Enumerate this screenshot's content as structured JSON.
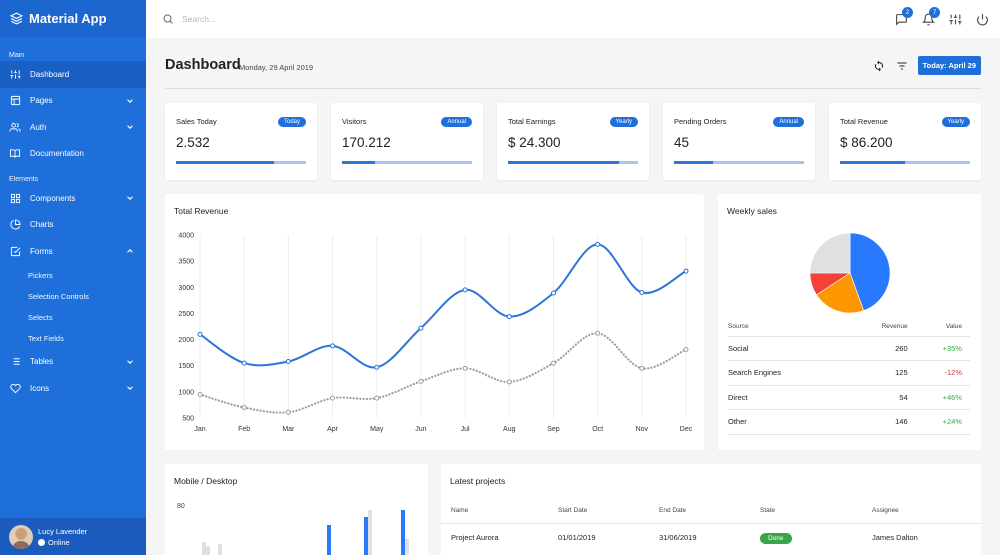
{
  "app": {
    "name": "Material App"
  },
  "sidebar": {
    "section_main": "Main",
    "section_elements": "Elements",
    "items": [
      {
        "label": "Dashboard"
      },
      {
        "label": "Pages"
      },
      {
        "label": "Auth"
      },
      {
        "label": "Documentation"
      },
      {
        "label": "Components"
      },
      {
        "label": "Charts"
      },
      {
        "label": "Forms"
      },
      {
        "label": "Tables"
      },
      {
        "label": "Icons"
      }
    ],
    "forms_sub": [
      {
        "label": "Pickers"
      },
      {
        "label": "Selection Controls"
      },
      {
        "label": "Selects"
      },
      {
        "label": "Text Fields"
      }
    ],
    "user": {
      "name": "Lucy Lavender",
      "status": "Online"
    }
  },
  "topbar": {
    "search_placeholder": "Search...",
    "messages_count": "2",
    "notifications_count": "7"
  },
  "header": {
    "title": "Dashboard",
    "date": "Monday, 29 April 2019",
    "today_button": "Today: April 29"
  },
  "stats": [
    {
      "label": "Sales Today",
      "badge": "Today",
      "value": "2.532",
      "progress": 0.75
    },
    {
      "label": "Visitors",
      "badge": "Annual",
      "value": "170.212",
      "progress": 0.25
    },
    {
      "label": "Total Earnings",
      "badge": "Yearly",
      "value": "$ 24.300",
      "progress": 0.85
    },
    {
      "label": "Pending Orders",
      "badge": "Annual",
      "value": "45",
      "progress": 0.3
    },
    {
      "label": "Total Revenue",
      "badge": "Yearly",
      "value": "$ 86.200",
      "progress": 0.5
    }
  ],
  "colors": {
    "primary": "#1e6fd9",
    "line1": "#2f74d8",
    "line2": "#9e9e9e",
    "positive": "#3aa548",
    "negative": "#dd3333"
  },
  "revenue": {
    "title": "Total Revenue"
  },
  "weekly": {
    "title": "Weekly sales",
    "columns": [
      "Source",
      "Revenue",
      "Value"
    ],
    "rows": [
      {
        "source": "Social",
        "revenue": "260",
        "value": "+35%"
      },
      {
        "source": "Search Engines",
        "revenue": "125",
        "value": "-12%"
      },
      {
        "source": "Direct",
        "revenue": "54",
        "value": "+46%"
      },
      {
        "source": "Other",
        "revenue": "146",
        "value": "+24%"
      }
    ]
  },
  "mobile": {
    "title": "Mobile / Desktop",
    "y_label": "80"
  },
  "projects": {
    "title": "Latest projects",
    "columns": [
      "Name",
      "Start Date",
      "End Date",
      "State",
      "Assignee"
    ],
    "rows": [
      {
        "name": "Project Aurora",
        "start": "01/01/2019",
        "end": "31/06/2019",
        "state": "Done",
        "assignee": "James Dalton"
      }
    ]
  },
  "chart_data": [
    {
      "type": "line",
      "title": "Total Revenue",
      "categories": [
        "Jan",
        "Feb",
        "Mar",
        "Apr",
        "May",
        "Jun",
        "Jul",
        "Aug",
        "Sep",
        "Oct",
        "Nov",
        "Dec"
      ],
      "ylim": [
        500,
        4000
      ],
      "yticks": [
        500,
        1000,
        1500,
        2000,
        2500,
        3000,
        3500,
        4000
      ],
      "grid": "vertical",
      "series": [
        {
          "values": [
            2100,
            1550,
            1580,
            1880,
            1470,
            2220,
            2950,
            2440,
            2890,
            3820,
            2900,
            3310
          ],
          "color": "#2f74d8",
          "style": "solid"
        },
        {
          "values": [
            950,
            700,
            610,
            880,
            880,
            1200,
            1450,
            1190,
            1550,
            2120,
            1450,
            1810
          ],
          "color": "#9e9e9e",
          "style": "dotted"
        }
      ]
    },
    {
      "type": "pie",
      "title": "Weekly sales",
      "labels": [
        "Social",
        "Search Engines",
        "Direct",
        "Other"
      ],
      "values": [
        260,
        125,
        54,
        146
      ],
      "colors": [
        "#2979ff",
        "#ff9800",
        "#f44336",
        "#e0e0e0"
      ]
    },
    {
      "type": "bar",
      "title": "Mobile / Desktop",
      "yticks": [
        80
      ],
      "series": [
        {
          "color": "#2979ff"
        },
        {
          "color": "#e0e0e0"
        }
      ]
    }
  ]
}
